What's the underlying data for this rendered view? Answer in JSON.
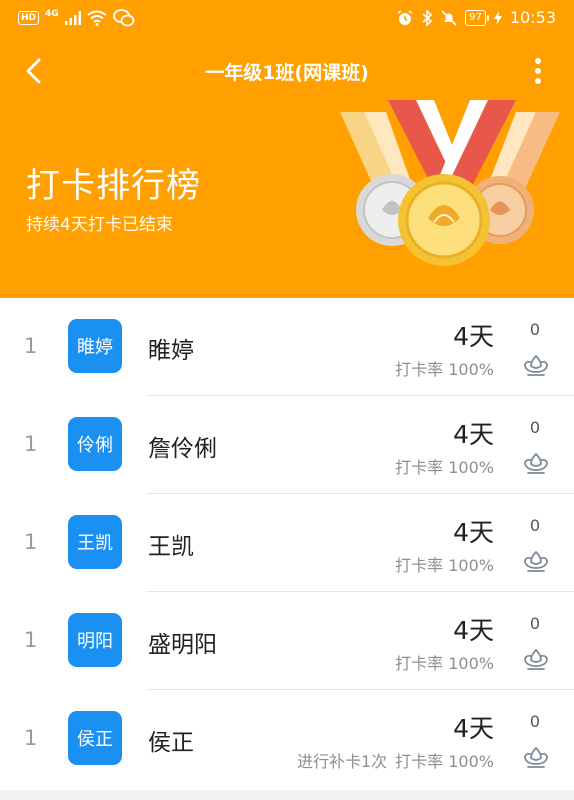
{
  "status_bar": {
    "hd": "HD",
    "network": "4G",
    "battery": "97",
    "time": "10:53"
  },
  "nav": {
    "title": "一年级1班(网课班)",
    "back_icon": "chevron-left-icon",
    "more_icon": "more-vertical-icon"
  },
  "banner": {
    "title": "打卡排行榜",
    "subtitle": "持续4天打卡已结束"
  },
  "colors": {
    "header_bg": "#ffa000",
    "avatar_bg": "#1a90f2"
  },
  "ranking": [
    {
      "rank": "1",
      "avatar_text": "睢婷",
      "name": "睢婷",
      "days": "4天",
      "makeup": "",
      "rate": "打卡率 100%",
      "likes": "0"
    },
    {
      "rank": "1",
      "avatar_text": "伶俐",
      "name": "詹伶俐",
      "days": "4天",
      "makeup": "",
      "rate": "打卡率 100%",
      "likes": "0"
    },
    {
      "rank": "1",
      "avatar_text": "王凯",
      "name": "王凯",
      "days": "4天",
      "makeup": "",
      "rate": "打卡率 100%",
      "likes": "0"
    },
    {
      "rank": "1",
      "avatar_text": "明阳",
      "name": "盛明阳",
      "days": "4天",
      "makeup": "",
      "rate": "打卡率 100%",
      "likes": "0"
    },
    {
      "rank": "1",
      "avatar_text": "侯正",
      "name": "侯正",
      "days": "4天",
      "makeup": "进行补卡1次",
      "rate": "打卡率 100%",
      "likes": "0"
    }
  ]
}
